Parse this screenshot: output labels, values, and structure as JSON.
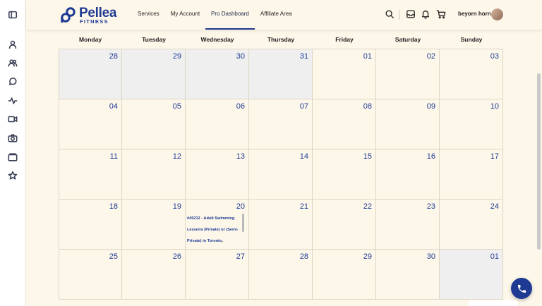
{
  "brand": {
    "name": "Pellea",
    "sub": "FITNESS",
    "color": "#1f3a93"
  },
  "nav": [
    {
      "label": "Services"
    },
    {
      "label": "My Account"
    },
    {
      "label": "Pro Dashboard",
      "active": true
    },
    {
      "label": "Affiliate Area"
    }
  ],
  "user": {
    "name": "beyorn horn"
  },
  "sidebar_icons": [
    "panel-toggle-icon",
    "user-icon",
    "group-icon",
    "chat-icon",
    "activity-icon",
    "video-icon",
    "camera-icon",
    "folder-icon",
    "star-icon"
  ],
  "topbar_icons": [
    "search-icon",
    "inbox-icon",
    "bell-icon",
    "cart-icon"
  ],
  "calendar": {
    "weekdays": [
      "Monday",
      "Tuesday",
      "Wednesday",
      "Thursday",
      "Friday",
      "Saturday",
      "Sunday"
    ],
    "weeks": [
      [
        {
          "day": "28",
          "other": true
        },
        {
          "day": "29",
          "other": true
        },
        {
          "day": "30",
          "other": true
        },
        {
          "day": "31",
          "other": true
        },
        {
          "day": "01"
        },
        {
          "day": "02"
        },
        {
          "day": "03"
        }
      ],
      [
        {
          "day": "04"
        },
        {
          "day": "05"
        },
        {
          "day": "06"
        },
        {
          "day": "07"
        },
        {
          "day": "08"
        },
        {
          "day": "09"
        },
        {
          "day": "10"
        }
      ],
      [
        {
          "day": "11"
        },
        {
          "day": "12"
        },
        {
          "day": "13"
        },
        {
          "day": "14"
        },
        {
          "day": "15"
        },
        {
          "day": "16"
        },
        {
          "day": "17"
        }
      ],
      [
        {
          "day": "18"
        },
        {
          "day": "19"
        },
        {
          "day": "20",
          "event": "#49212 - Adult Swimming Lessons (Private) or (Semi-Private) in Toronto,"
        },
        {
          "day": "21"
        },
        {
          "day": "22"
        },
        {
          "day": "23"
        },
        {
          "day": "24"
        }
      ],
      [
        {
          "day": "25"
        },
        {
          "day": "26"
        },
        {
          "day": "27"
        },
        {
          "day": "28"
        },
        {
          "day": "29"
        },
        {
          "day": "30"
        },
        {
          "day": "01",
          "other": true
        }
      ]
    ]
  }
}
